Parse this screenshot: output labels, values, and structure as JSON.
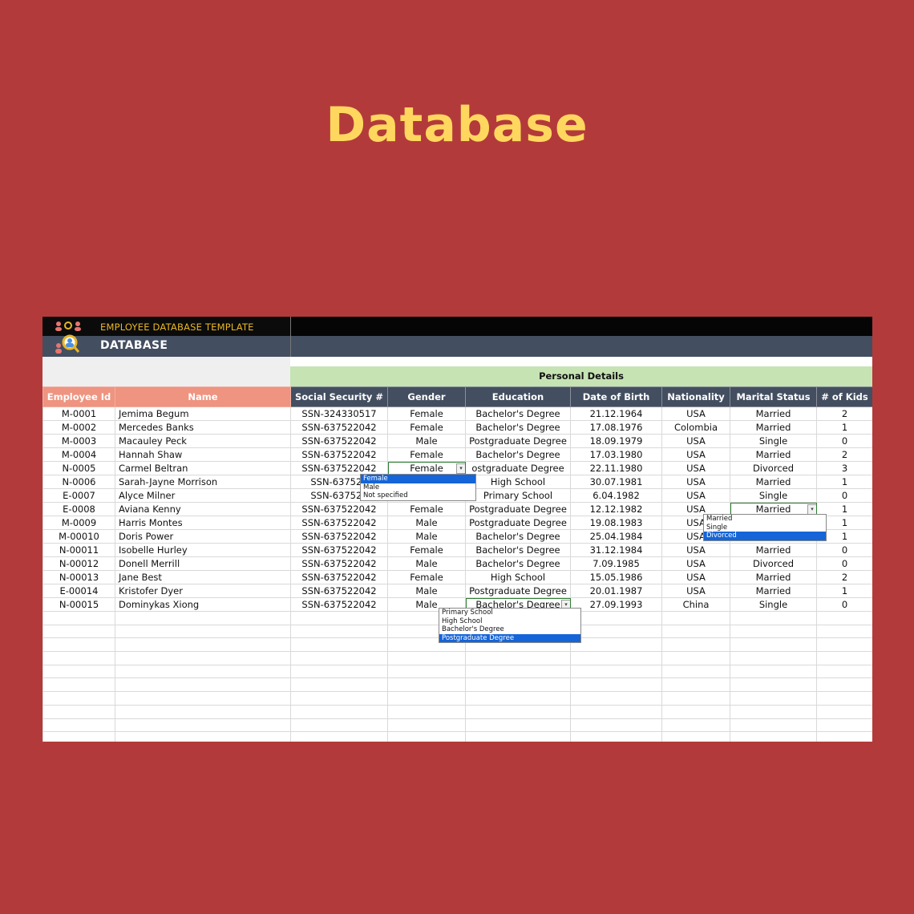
{
  "page": {
    "title": "Database"
  },
  "sheet": {
    "template_title": "EMPLOYEE DATABASE TEMPLATE",
    "heading": "DATABASE",
    "group_header": "Personal Details",
    "columns": [
      "Employee Id",
      "Name",
      "Social Security #",
      "Gender",
      "Education",
      "Date of Birth",
      "Nationality",
      "Marital Status",
      "# of Kids"
    ],
    "rows": [
      [
        "M-0001",
        "Jemima Begum",
        "SSN-324330517",
        "Female",
        "Bachelor's Degree",
        "21.12.1964",
        "USA",
        "Married",
        "2"
      ],
      [
        "M-0002",
        "Mercedes Banks",
        "SSN-637522042",
        "Female",
        "Bachelor's Degree",
        "17.08.1976",
        "Colombia",
        "Married",
        "1"
      ],
      [
        "M-0003",
        "Macauley Peck",
        "SSN-637522042",
        "Male",
        "Postgraduate Degree",
        "18.09.1979",
        "USA",
        "Single",
        "0"
      ],
      [
        "M-0004",
        "Hannah Shaw",
        "SSN-637522042",
        "Female",
        "Bachelor's Degree",
        "17.03.1980",
        "USA",
        "Married",
        "2"
      ],
      [
        "N-0005",
        "Carmel Beltran",
        "SSN-637522042",
        "Female",
        "ostgraduate Degree",
        "22.11.1980",
        "USA",
        "Divorced",
        "3"
      ],
      [
        "N-0006",
        "Sarah-Jayne Morrison",
        "SSN-637522",
        "",
        "High School",
        "30.07.1981",
        "USA",
        "Married",
        "1"
      ],
      [
        "E-0007",
        "Alyce Milner",
        "SSN-637522",
        "",
        "Primary School",
        "6.04.1982",
        "USA",
        "Single",
        "0"
      ],
      [
        "E-0008",
        "Aviana Kenny",
        "SSN-637522042",
        "Female",
        "Postgraduate Degree",
        "12.12.1982",
        "USA",
        "Married",
        "1"
      ],
      [
        "M-0009",
        "Harris Montes",
        "SSN-637522042",
        "Male",
        "Postgraduate Degree",
        "19.08.1983",
        "USA",
        "",
        "1"
      ],
      [
        "M-00010",
        "Doris Power",
        "SSN-637522042",
        "Male",
        "Bachelor's Degree",
        "25.04.1984",
        "USA",
        "",
        "1"
      ],
      [
        "N-00011",
        "Isobelle Hurley",
        "SSN-637522042",
        "Female",
        "Bachelor's Degree",
        "31.12.1984",
        "USA",
        "Married",
        "0"
      ],
      [
        "N-00012",
        "Donell Merrill",
        "SSN-637522042",
        "Male",
        "Bachelor's Degree",
        "7.09.1985",
        "USA",
        "Divorced",
        "0"
      ],
      [
        "N-00013",
        "Jane Best",
        "SSN-637522042",
        "Female",
        "High School",
        "15.05.1986",
        "USA",
        "Married",
        "2"
      ],
      [
        "E-00014",
        "Kristofer Dyer",
        "SSN-637522042",
        "Male",
        "Postgraduate Degree",
        "20.01.1987",
        "USA",
        "Married",
        "1"
      ],
      [
        "N-00015",
        "Dominykas Xiong",
        "SSN-637522042",
        "Male",
        "Bachelor's Degree",
        "27.09.1993",
        "China",
        "Single",
        "0"
      ]
    ],
    "empty_rows": 10,
    "dropdowns": {
      "gender": {
        "options": [
          "Female",
          "Male",
          "Not specified"
        ],
        "selected": "Female"
      },
      "marital": {
        "options": [
          "Married",
          "Single",
          "Divorced"
        ],
        "selected": "Divorced"
      },
      "education": {
        "options": [
          "Primary School",
          "High School",
          "Bachelor's Degree",
          "Postgraduate Degree"
        ],
        "selected": "Postgraduate Degree"
      }
    }
  },
  "colors": {
    "background": "#B33A3A",
    "title": "#FFD75E",
    "header_pink": "#EE9480",
    "header_slate": "#434E60",
    "group_green": "#C6E3B4",
    "selection_blue": "#1565D8",
    "accent_gold": "#E8B627"
  },
  "icons": [
    "people-search-icon",
    "dropdown-arrow-icon"
  ]
}
